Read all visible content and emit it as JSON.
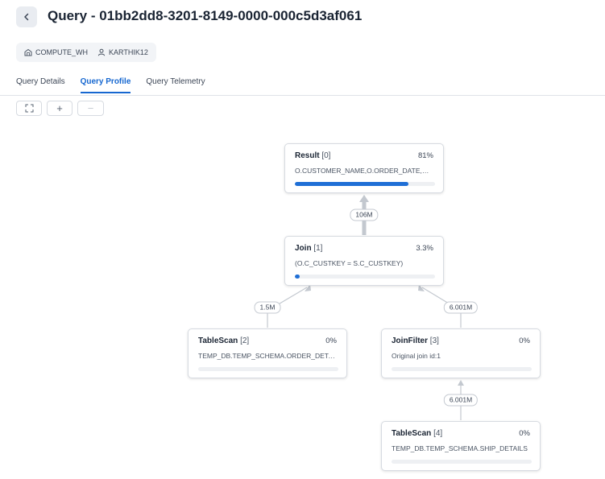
{
  "header": {
    "title": "Query - 01bb2dd8-3201-8149-0000-000c5d3af061",
    "warehouse": "COMPUTE_WH",
    "user": "KARTHIK12"
  },
  "tabs": [
    {
      "label": "Query Details",
      "active": false
    },
    {
      "label": "Query Profile",
      "active": true
    },
    {
      "label": "Query Telemetry",
      "active": false
    }
  ],
  "toolbar": {
    "fit_icon": "fit-to-screen-icon",
    "zoom_in_label": "+",
    "zoom_out_label": "−"
  },
  "nodes": [
    {
      "op": "Result",
      "id": "[0]",
      "pct": "81%",
      "pct_value": 0.81,
      "detail": "O.CUSTOMER_NAME,O.ORDER_DATE,S.SHIP_DATE"
    },
    {
      "op": "Join",
      "id": "[1]",
      "pct": "3.3%",
      "pct_value": 0.033,
      "detail": "(O.C_CUSTKEY = S.C_CUSTKEY)"
    },
    {
      "op": "TableScan",
      "id": "[2]",
      "pct": "0%",
      "pct_value": 0,
      "detail": "TEMP_DB.TEMP_SCHEMA.ORDER_DETAILS"
    },
    {
      "op": "JoinFilter",
      "id": "[3]",
      "pct": "0%",
      "pct_value": 0,
      "detail": "Original join id:1"
    },
    {
      "op": "TableScan",
      "id": "[4]",
      "pct": "0%",
      "pct_value": 0,
      "detail": "TEMP_DB.TEMP_SCHEMA.SHIP_DETAILS"
    }
  ],
  "edges": [
    {
      "label": "106M"
    },
    {
      "label": "1.5M"
    },
    {
      "label": "6.001M"
    },
    {
      "label": "6.001M"
    }
  ],
  "colors": {
    "accent": "#1667d0",
    "bar": "#1f6fd6"
  }
}
